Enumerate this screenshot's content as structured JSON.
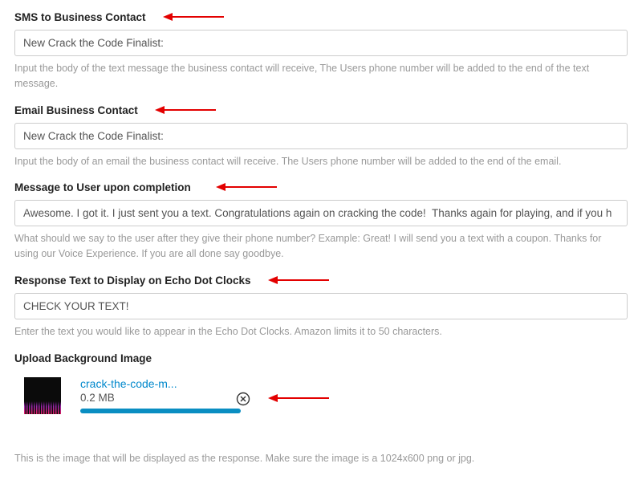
{
  "smsContact": {
    "label": "SMS to Business Contact",
    "value": "New Crack the Code Finalist:",
    "help": "Input the body of the text message the business contact will receive, The Users phone number will be added to the end of the text message."
  },
  "emailContact": {
    "label": "Email Business Contact",
    "value": "New Crack the Code Finalist:",
    "help": "Input the body of an email the business contact will receive. The Users phone number will be added to the end of the email."
  },
  "userMessage": {
    "label": "Message to User upon completion",
    "value": "Awesome. I got it. I just sent you a text. Congratulations again on cracking the code!  Thanks again for playing, and if you h",
    "help": "What should we say to the user after they give their phone number? Example: Great! I will send you a text with a coupon. Thanks for using our Voice Experience. If you are all done say goodbye."
  },
  "echoText": {
    "label": "Response Text to Display on Echo Dot Clocks",
    "value": "CHECK YOUR TEXT!",
    "help": "Enter the text you would like to appear in the Echo Dot Clocks. Amazon limits it to 50 characters."
  },
  "upload": {
    "label": "Upload Background Image",
    "fileName": "crack-the-code-m...",
    "fileSize": "0.2 MB",
    "help": "This is the image that will be displayed as the response. Make sure the image is a 1024x600 png or jpg."
  }
}
